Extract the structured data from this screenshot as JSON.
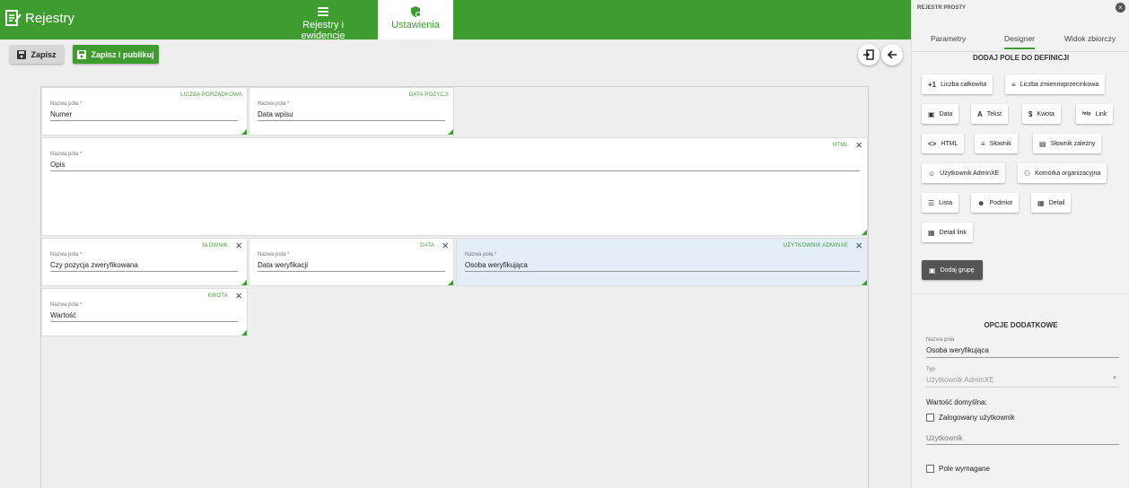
{
  "app": {
    "title": "Rejestry"
  },
  "nav": {
    "tabs": [
      {
        "label": "Rejestry i ewidencje",
        "icon": "list-icon",
        "active": false
      },
      {
        "label": "Ustawienia",
        "icon": "settings-icon",
        "active": true
      }
    ]
  },
  "toolbar": {
    "save_label": "Zapisz",
    "publish_label": "Zapisz i publikuj"
  },
  "fields": [
    {
      "type": "LICZBA PORZĄDKOWA",
      "label": "Nazwa pola *",
      "value": "Numer",
      "closable": false
    },
    {
      "type": "DATA POZYCJI",
      "label": "Nazwa pola *",
      "value": "Data wpisu",
      "closable": false
    },
    {
      "type": "HTML",
      "label": "Nazwa pola *",
      "value": "Opis",
      "closable": true
    },
    {
      "type": "SŁOWNIK",
      "label": "Nazwa pola *",
      "value": "Czy pozycja zweryfikowana",
      "closable": true
    },
    {
      "type": "DATA",
      "label": "Nazwa pola *",
      "value": "Data weryfikacji",
      "closable": true
    },
    {
      "type": "UŻYTKOWNIK ADMINXE",
      "label": "Nazwa pola *",
      "value": "Osoba weryfikująca",
      "closable": true,
      "selected": true
    },
    {
      "type": "KWOTA",
      "label": "Nazwa pola *",
      "value": "Wartość",
      "closable": true
    }
  ],
  "panel": {
    "title": "REJESTR PROSTY",
    "tabs": [
      "Parametry",
      "Designer",
      "Widok zbiorczy"
    ],
    "active_tab": "Designer",
    "add_heading": "DODAJ POLE DO DEFINICJI",
    "field_buttons": [
      {
        "label": "Liczba całkowita",
        "icon": "+1"
      },
      {
        "label": "Liczba zmiennoprzecinkowa",
        "icon": "≡"
      },
      {
        "label": "Data",
        "icon": "▣"
      },
      {
        "label": "Tekst",
        "icon": "A"
      },
      {
        "label": "Kwota",
        "icon": "$"
      },
      {
        "label": "Link",
        "icon": "http"
      },
      {
        "label": "HTML",
        "icon": "<>"
      },
      {
        "label": "Słownik",
        "icon": "≡"
      },
      {
        "label": "Słownik zależny",
        "icon": "▤"
      },
      {
        "label": "Użytkownik AdminXE",
        "icon": "☺"
      },
      {
        "label": "Komórka organizacyjna",
        "icon": "⚇"
      },
      {
        "label": "Lista",
        "icon": "☰"
      },
      {
        "label": "Podmiot",
        "icon": "☻"
      },
      {
        "label": "Detail",
        "icon": "▦"
      },
      {
        "label": "Detail link",
        "icon": "▦"
      }
    ],
    "add_group_label": "Dodaj grupę",
    "options_heading": "OPCJE DODATKOWE",
    "options": {
      "name_label": "Nazwa pola",
      "name_value": "Osoba weryfikująca",
      "type_label": "Typ",
      "type_value": "Użytkownik AdminXE",
      "default_label": "Wartość domyślna:",
      "logged_user_label": "Zalogowany użytkownik",
      "user_placeholder": "Użytkownik",
      "required_label": "Pole wymagane"
    }
  },
  "colors": {
    "accent": "#3f9d2f",
    "selected": "#e3eef9"
  }
}
